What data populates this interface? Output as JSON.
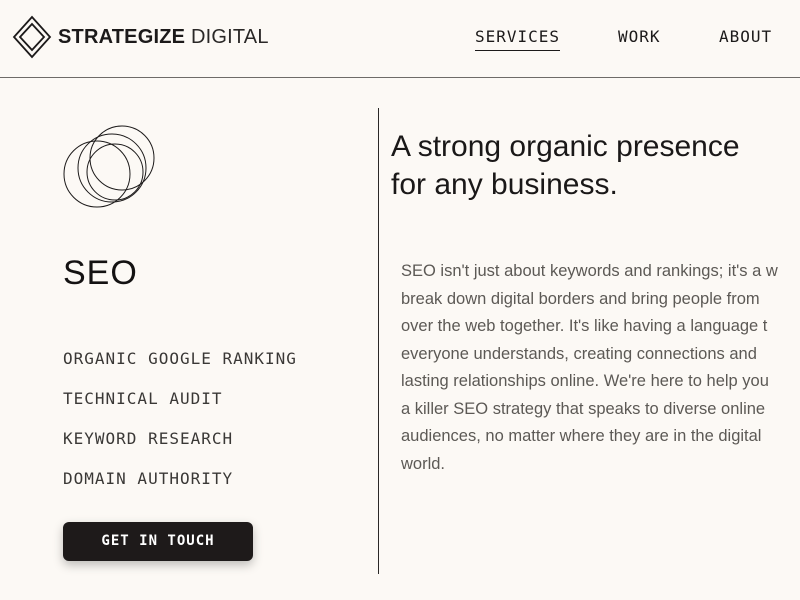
{
  "brand": {
    "name_bold": "STRATEGIZE",
    "name_light": "DIGITAL",
    "logo_icon": "diamond-logo-icon"
  },
  "nav": {
    "items": [
      {
        "label": "SERVICES",
        "active": true
      },
      {
        "label": "WORK",
        "active": false
      },
      {
        "label": "ABOUT",
        "active": false
      }
    ]
  },
  "service": {
    "icon": "overlapping-circles-icon",
    "title": "SEO",
    "features": [
      "ORGANIC GOOGLE RANKING",
      "TECHNICAL AUDIT",
      "KEYWORD RESEARCH",
      "DOMAIN AUTHORITY"
    ],
    "cta_label": "GET IN TOUCH"
  },
  "content": {
    "headline_lines": [
      "A strong organic presence",
      "for any business."
    ],
    "body_lines": [
      "SEO isn't just about keywords and rankings; it's a w",
      "break down digital borders and bring people from",
      "over the web together. It's like having a language t",
      "everyone understands, creating connections and",
      "lasting relationships online. We're here to help you",
      "a killer SEO strategy that speaks to diverse online",
      "audiences, no matter where they are in the digital",
      "world."
    ]
  },
  "colors": {
    "background": "#fcf9f5",
    "text_dark": "#1c1a1a",
    "text_body": "#5c5955",
    "button_bg": "#1e1a1a",
    "button_text": "#ffffff"
  }
}
